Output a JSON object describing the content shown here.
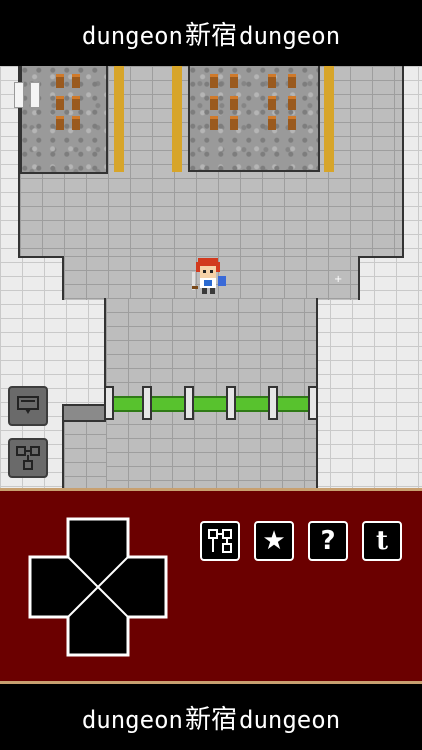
{
  "banner": {
    "logo_left": "dungeon",
    "logo_kanji": "新宿",
    "logo_right": "dungeon"
  },
  "hud": {
    "pause_icon": "pause-icon",
    "message_icon": "speech-bubble-icon",
    "minimap_icon": "minimap-icon"
  },
  "controls": {
    "dpad_icon": "dpad-icon",
    "buttons": [
      {
        "name": "map-button",
        "icon": "map-icon",
        "label": ""
      },
      {
        "name": "favorite-button",
        "icon": "star-icon",
        "label": "★"
      },
      {
        "name": "help-button",
        "icon": "question-icon",
        "label": "?"
      },
      {
        "name": "twitter-button",
        "icon": "twitter-icon",
        "label": "t"
      }
    ]
  },
  "colors": {
    "panel": "#6b0000",
    "panel_border": "#c8a070",
    "floor": "#bdbdbd",
    "wall": "#ececec",
    "fence": "#58c22e",
    "pillar": "#d7a52a"
  }
}
